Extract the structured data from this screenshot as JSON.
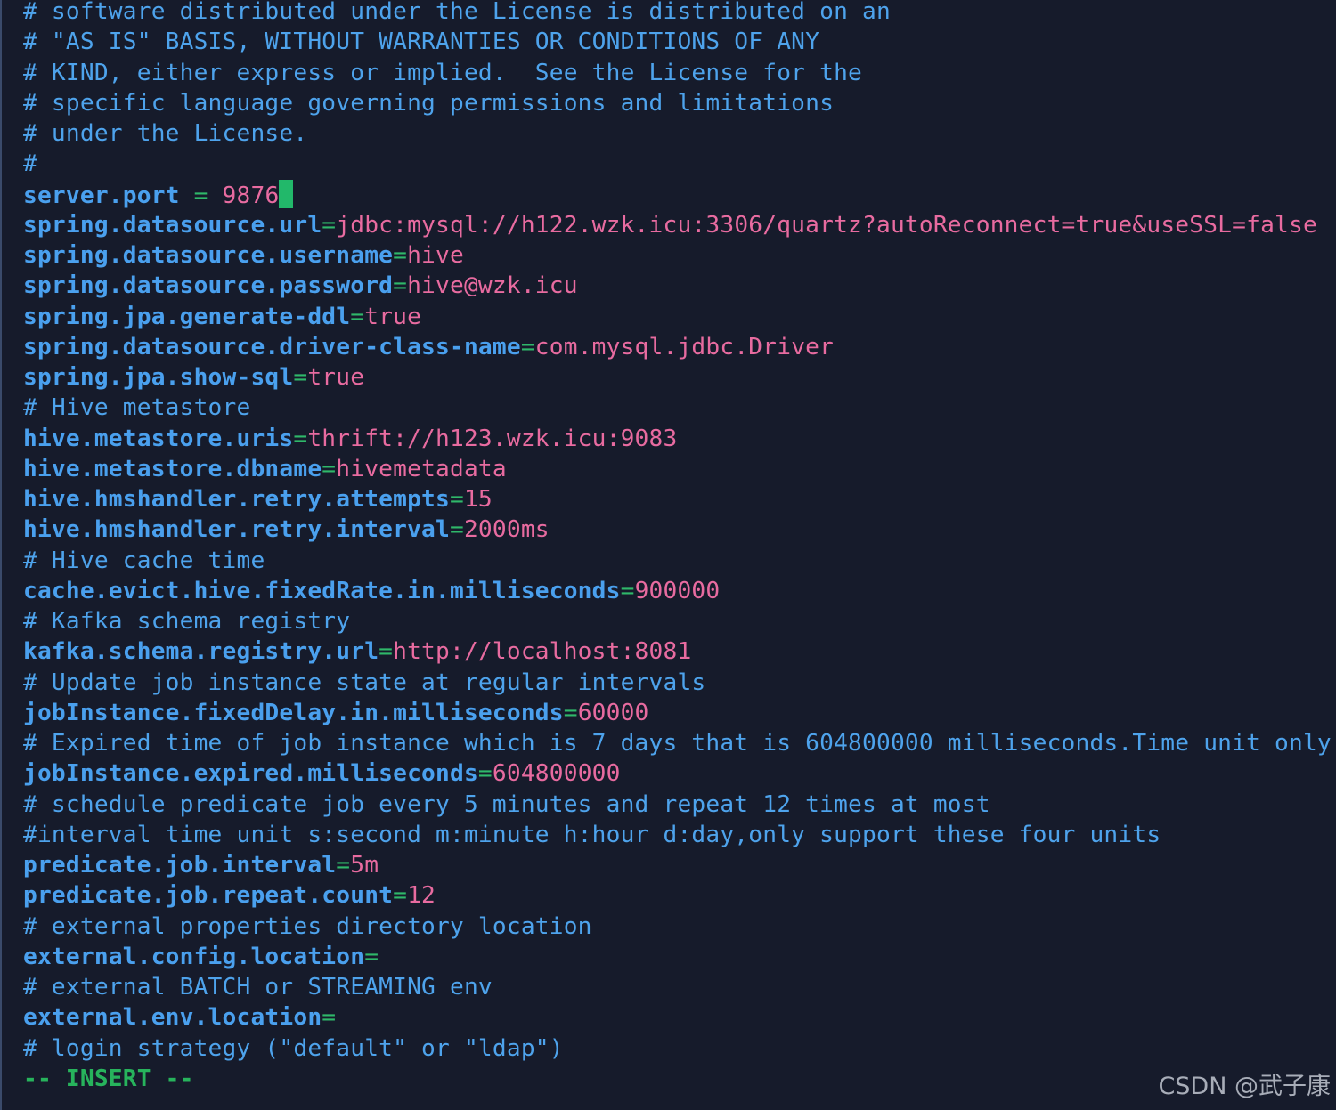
{
  "lines": [
    {
      "type": "comment",
      "text": "# software distributed under the License is distributed on an"
    },
    {
      "type": "comment",
      "text": "# \"AS IS\" BASIS, WITHOUT WARRANTIES OR CONDITIONS OF ANY"
    },
    {
      "type": "comment",
      "text": "# KIND, either express or implied.  See the License for the"
    },
    {
      "type": "comment",
      "text": "# specific language governing permissions and limitations"
    },
    {
      "type": "comment",
      "text": "# under the License."
    },
    {
      "type": "comment",
      "text": "#"
    },
    {
      "type": "kv",
      "key": "server.port",
      "sep": " = ",
      "value": "9876",
      "cursor": true
    },
    {
      "type": "kv",
      "key": "spring.datasource.url",
      "sep": "=",
      "value": "jdbc:mysql://h122.wzk.icu:3306/quartz?autoReconnect=true&useSSL=false"
    },
    {
      "type": "kv",
      "key": "spring.datasource.username",
      "sep": "=",
      "value": "hive"
    },
    {
      "type": "kv",
      "key": "spring.datasource.password",
      "sep": "=",
      "value": "hive@wzk.icu"
    },
    {
      "type": "kv",
      "key": "spring.jpa.generate-ddl",
      "sep": "=",
      "value": "true"
    },
    {
      "type": "kv",
      "key": "spring.datasource.driver-class-name",
      "sep": "=",
      "value": "com.mysql.jdbc.Driver"
    },
    {
      "type": "kv",
      "key": "spring.jpa.show-sql",
      "sep": "=",
      "value": "true"
    },
    {
      "type": "comment",
      "text": "# Hive metastore"
    },
    {
      "type": "kv",
      "key": "hive.metastore.uris",
      "sep": "=",
      "value": "thrift://h123.wzk.icu:9083"
    },
    {
      "type": "kv",
      "key": "hive.metastore.dbname",
      "sep": "=",
      "value": "hivemetadata"
    },
    {
      "type": "kv",
      "key": "hive.hmshandler.retry.attempts",
      "sep": "=",
      "value": "15"
    },
    {
      "type": "kv",
      "key": "hive.hmshandler.retry.interval",
      "sep": "=",
      "value": "2000ms"
    },
    {
      "type": "comment",
      "text": "# Hive cache time"
    },
    {
      "type": "kv",
      "key": "cache.evict.hive.fixedRate.in.milliseconds",
      "sep": "=",
      "value": "900000"
    },
    {
      "type": "comment",
      "text": "# Kafka schema registry"
    },
    {
      "type": "kv",
      "key": "kafka.schema.registry.url",
      "sep": "=",
      "value": "http://localhost:8081"
    },
    {
      "type": "comment",
      "text": "# Update job instance state at regular intervals"
    },
    {
      "type": "kv",
      "key": "jobInstance.fixedDelay.in.milliseconds",
      "sep": "=",
      "value": "60000"
    },
    {
      "type": "comment",
      "text": "# Expired time of job instance which is 7 days that is 604800000 milliseconds.Time unit only"
    },
    {
      "type": "kv",
      "key": "jobInstance.expired.milliseconds",
      "sep": "=",
      "value": "604800000"
    },
    {
      "type": "comment",
      "text": "# schedule predicate job every 5 minutes and repeat 12 times at most"
    },
    {
      "type": "comment",
      "text": "#interval time unit s:second m:minute h:hour d:day,only support these four units"
    },
    {
      "type": "kv",
      "key": "predicate.job.interval",
      "sep": "=",
      "value": "5m"
    },
    {
      "type": "kv",
      "key": "predicate.job.repeat.count",
      "sep": "=",
      "value": "12"
    },
    {
      "type": "comment",
      "text": "# external properties directory location"
    },
    {
      "type": "kv",
      "key": "external.config.location",
      "sep": "=",
      "value": ""
    },
    {
      "type": "comment",
      "text": "# external BATCH or STREAMING env"
    },
    {
      "type": "kv",
      "key": "external.env.location",
      "sep": "=",
      "value": ""
    },
    {
      "type": "comment",
      "text": "# login strategy (\"default\" or \"ldap\")"
    }
  ],
  "status": {
    "prefix": "-- ",
    "mode": "INSERT",
    "suffix": " --"
  },
  "watermark": "CSDN @武子康",
  "colors": {
    "background": "#161b2b",
    "comment": "#4ea3ec",
    "key": "#4aa0ee",
    "equals": "#2fb86a",
    "value": "#e86ba0",
    "cursor": "#22b86a",
    "mode": "#27b35c"
  }
}
